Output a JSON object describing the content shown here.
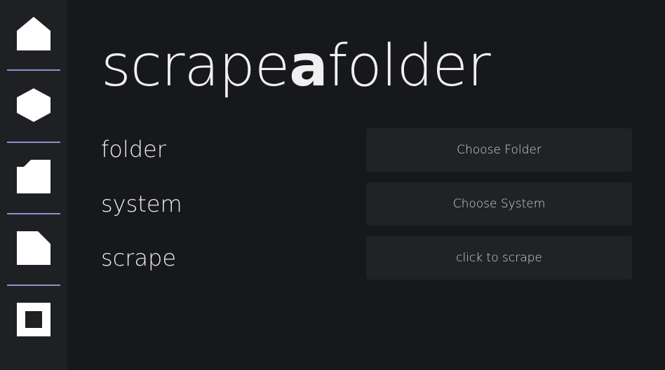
{
  "sidebar": {
    "items": [
      {
        "icon": "home-icon"
      },
      {
        "icon": "hexagon-icon"
      },
      {
        "icon": "folder-icon"
      },
      {
        "icon": "file-icon"
      },
      {
        "icon": "stop-icon"
      }
    ]
  },
  "header": {
    "title_prefix": "scrape",
    "title_bold": "a",
    "title_suffix": "folder"
  },
  "rows": [
    {
      "label": "folder",
      "button": "Choose Folder"
    },
    {
      "label": "system",
      "button": "Choose System"
    },
    {
      "label": "scrape",
      "button": "click to scrape"
    }
  ],
  "colors": {
    "background": "#17181c",
    "sidebar": "#1f2024",
    "divider": "#8f8fc8",
    "button": "#212226",
    "text": "#ededed"
  }
}
